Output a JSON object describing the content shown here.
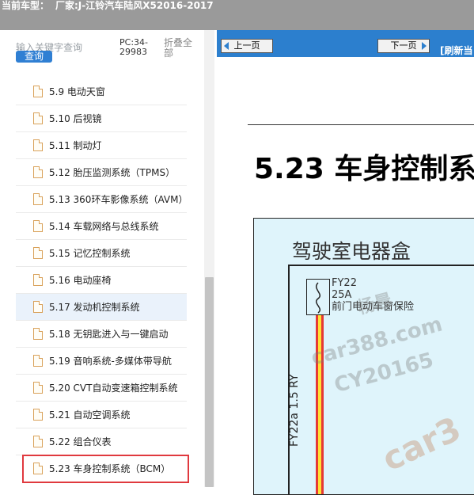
{
  "header": {
    "current_model_label": "当前车型：",
    "current_model_value": "厂家:J-江铃汽车陆风X52016-2017"
  },
  "sidebar": {
    "search_placeholder": "输入关键字查询",
    "search_button": "查询",
    "pc_code": "PC:34-29983",
    "collapse_all": "折叠全部",
    "items": [
      {
        "label": "5.9 电动天窗"
      },
      {
        "label": "5.10 后视镜"
      },
      {
        "label": "5.11 制动灯"
      },
      {
        "label": "5.12 胎压监测系统（TPMS）"
      },
      {
        "label": "5.13 360环车影像系统（AVM）"
      },
      {
        "label": "5.14 车载网络与总线系统"
      },
      {
        "label": "5.15 记忆控制系统"
      },
      {
        "label": "5.16 电动座椅"
      },
      {
        "label": "5.17 发动机控制系统"
      },
      {
        "label": "5.18 无钥匙进入与一键启动"
      },
      {
        "label": "5.19 音响系统-多媒体带导航"
      },
      {
        "label": "5.20 CVT自动变速箱控制系统"
      },
      {
        "label": "5.21 自动空调系统"
      },
      {
        "label": "5.22 组合仪表"
      },
      {
        "label": "5.23 车身控制系统（BCM）"
      }
    ]
  },
  "viewer": {
    "prev_button": "上一页",
    "next_button": "下一页",
    "refresh_label": "[刷新当",
    "section_title": "5.23 车身控制系",
    "diagram": {
      "title": "驾驶室电器盒",
      "fuse_id": "FY22",
      "fuse_rating": "25A",
      "fuse_desc": "前门电动车窗保险",
      "wire_label": "FY22a 1.5 RY"
    },
    "watermark": {
      "line1": "杨晨",
      "line2": "car388.com",
      "line3": "CY20165",
      "line4": "car3"
    }
  },
  "colors": {
    "topbar": "#9a9a9a",
    "navbar": "#2c7fce",
    "search_button": "#2f7fd3",
    "selected_outline": "#e0393e",
    "diagram_bg": "#dff4fb"
  }
}
